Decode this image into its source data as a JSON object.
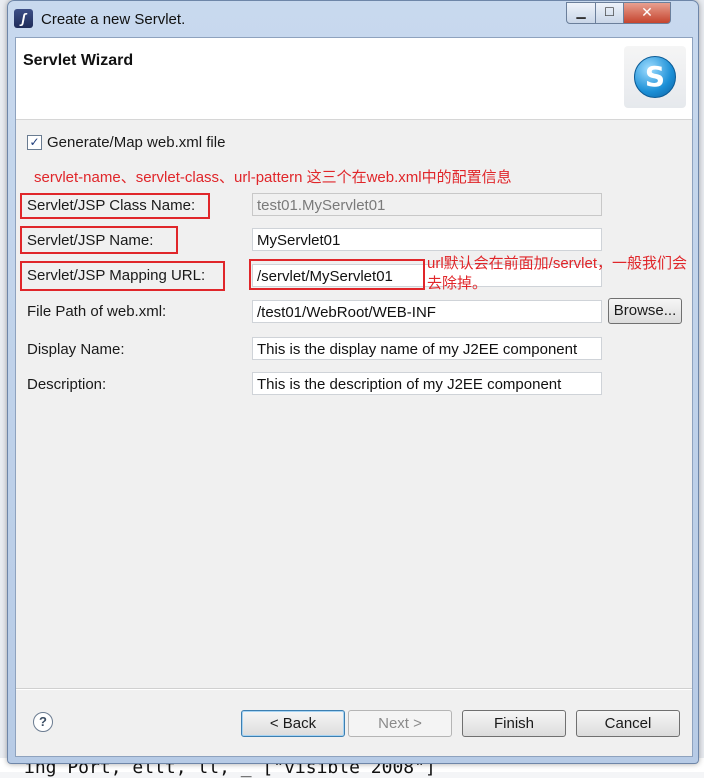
{
  "window": {
    "title": "Create a new Servlet.",
    "minimize_glyph": "▁",
    "maximize_glyph": "☐",
    "close_glyph": "✕"
  },
  "banner": {
    "title": "Servlet Wizard",
    "logo_glyph": "S"
  },
  "form": {
    "generate_checkbox": {
      "checked": true,
      "check_glyph": "✓",
      "label": "Generate/Map web.xml file"
    },
    "annotation_top": "servlet-name、servlet-class、url-pattern 这三个在web.xml中的配置信息",
    "annotation_right": "url默认会在前面加/servlet，一般我们会去除掉。",
    "class_name": {
      "label": "Servlet/JSP Class Name:",
      "value": "test01.MyServlet01"
    },
    "name": {
      "label": "Servlet/JSP Name:",
      "value": "MyServlet01"
    },
    "mapping_url": {
      "label": "Servlet/JSP Mapping URL:",
      "value": "/servlet/MyServlet01"
    },
    "file_path": {
      "label": "File Path of web.xml:",
      "value": "/test01/WebRoot/WEB-INF",
      "browse_label": "Browse..."
    },
    "display_name": {
      "label": "Display Name:",
      "value": "This is the display name of my J2EE component"
    },
    "description": {
      "label": "Description:",
      "value": "This is the description of my J2EE component"
    }
  },
  "footer": {
    "help_glyph": "?",
    "back_label": "< Back",
    "next_label": "Next >",
    "finish_label": "Finish",
    "cancel_label": "Cancel"
  },
  "background": {
    "bottom_code_text": "ing Port, ellt, ll, _ [\"visible 2008\"]"
  }
}
